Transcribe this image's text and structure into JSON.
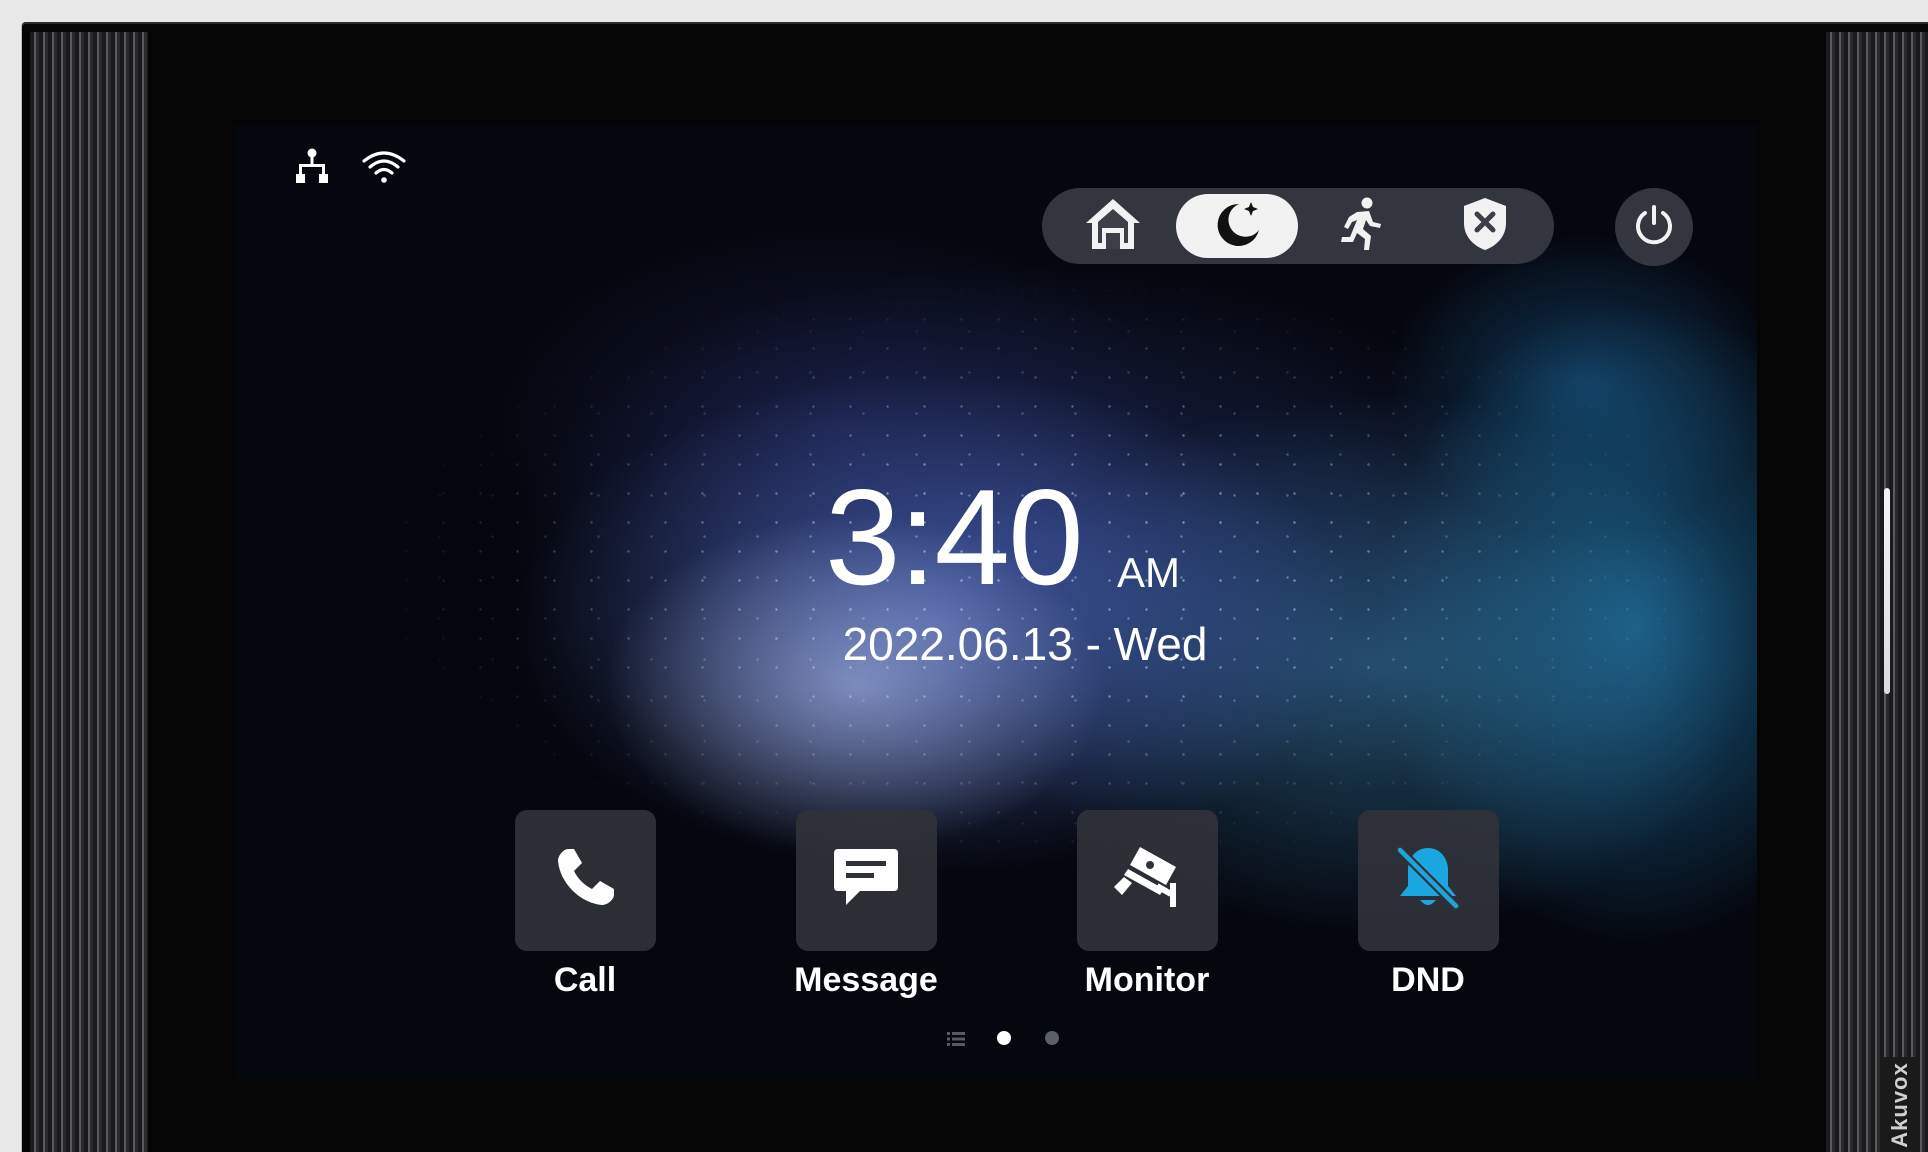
{
  "status_bar": {
    "icons": [
      "network-icon",
      "wifi-icon"
    ]
  },
  "arming_modes": [
    {
      "name": "home",
      "icon": "home-icon",
      "active": false
    },
    {
      "name": "night",
      "icon": "moon-icon",
      "active": true
    },
    {
      "name": "away",
      "icon": "running-person-icon",
      "active": false
    },
    {
      "name": "disarm",
      "icon": "shield-x-icon",
      "active": false
    }
  ],
  "power_icon": "power-icon",
  "clock": {
    "time": "3:40",
    "ampm": "AM",
    "date": "2022.06.13 - Wed"
  },
  "apps": [
    {
      "label": "Call",
      "icon": "phone-icon"
    },
    {
      "label": "Message",
      "icon": "message-icon"
    },
    {
      "label": "Monitor",
      "icon": "camera-icon"
    },
    {
      "label": "DND",
      "icon": "bell-off-icon",
      "accent": "#1aa7e0"
    }
  ],
  "pager": {
    "current_page": 1,
    "pages": 2
  },
  "device": {
    "brand": "Akuvox"
  },
  "colors": {
    "dnd_accent": "#1aa7e0",
    "active_mode_bg": "#f2f2f2"
  }
}
